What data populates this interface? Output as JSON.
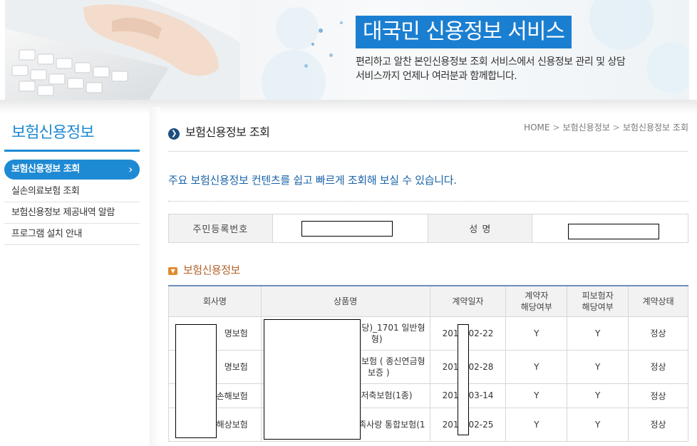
{
  "banner": {
    "title": "대국민 신용정보 서비스",
    "desc_line1": "편리하고 알찬 본인신용정보 조회 서비스에서 신용정보 관리 및 상담",
    "desc_line2": "서비스까지 언제나 여러분과 함께합니다."
  },
  "sidebar": {
    "title": "보험신용정보",
    "items": [
      {
        "label": "보험신용정보 조회"
      },
      {
        "label": "실손의료보험 조회"
      },
      {
        "label": "보험신용정보 제공내역 알람"
      },
      {
        "label": "프로그램 설치 안내"
      }
    ]
  },
  "page": {
    "title": "보험신용정보 조회",
    "breadcrumb": [
      "HOME",
      "보험신용정보",
      "보험신용정보 조회"
    ],
    "intro": "주요 보험신용정보 컨텐츠를 쉽고 빠르게 조회해 보실 수 있습니다."
  },
  "identity": {
    "rrn_label": "주민등록번호",
    "name_label": "성 명"
  },
  "insurance": {
    "section_title": "보험신용정보",
    "headers": [
      "회사명",
      "상품명",
      "계약일자",
      "계약자\n해당여부",
      "피보험자\n해당여부",
      "계약상태"
    ],
    "header_lines": {
      "contractor": [
        "계약자",
        "해당여부"
      ],
      "insured": [
        "피보험자",
        "해당여부"
      ]
    },
    "rows": [
      {
        "company": "명보험",
        "product_l1": "배당)_1701 일반형",
        "product_l2": "형)",
        "date_a": "201",
        "date_b": "02-22",
        "contractor": "Y",
        "insured": "Y",
        "status": "정상"
      },
      {
        "company": "명보험",
        "product_l1": "보험 ( 종신연금형",
        "product_l2": "보증 )",
        "date_a": "201",
        "date_b": "02-28",
        "contractor": "Y",
        "insured": "Y",
        "status": "정상"
      },
      {
        "company": "손해보험",
        "product_l1": "저축보험(1종)",
        "product_l2": "",
        "date_a": "201",
        "date_b": "03-14",
        "contractor": "Y",
        "insured": "Y",
        "status": "정상"
      },
      {
        "company": "해상보험",
        "product_l1": "족사랑 통합보험(1",
        "product_l2": "",
        "date_a": "201",
        "date_b": "02-25",
        "contractor": "Y",
        "insured": "Y",
        "status": "정상"
      }
    ]
  },
  "colors": {
    "accent_blue": "#1f8ad4",
    "banner_title_bg": "#1b7fd1",
    "section_orange": "#b5622a"
  }
}
